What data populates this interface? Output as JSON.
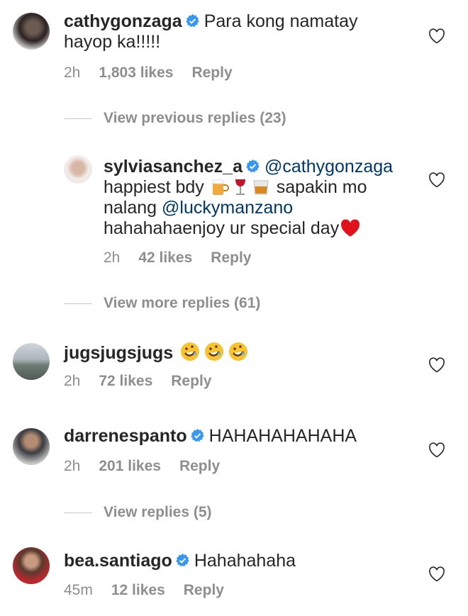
{
  "comments": [
    {
      "user": "cathygonzaga",
      "text": "Para kong namatay",
      "text2": "hayop ka!!!!!",
      "time": "2h",
      "likes": "1,803 likes",
      "reply": "Reply"
    },
    {
      "user": "sylviasanchez_a",
      "mention": "@cathygonzaga",
      "line2a": "happiest bdy",
      "line2b": "sapakin mo",
      "line3a": "nalang",
      "mention2": "@luckymanzano",
      "line4": "hahahahaenjoy ur special day",
      "time": "2h",
      "likes": "42 likes",
      "reply": "Reply"
    },
    {
      "user": "jugsjugsjugs",
      "time": "2h",
      "likes": "72 likes",
      "reply": "Reply"
    },
    {
      "user": "darrenespanto",
      "text": "HAHAHAHAHAHA",
      "time": "2h",
      "likes": "201 likes",
      "reply": "Reply"
    },
    {
      "user": "bea.santiago",
      "text": "Hahahahaha",
      "time": "45m",
      "likes": "12 likes",
      "reply": "Reply"
    }
  ],
  "view_previous": "View previous replies (23)",
  "view_more": "View more replies (61)",
  "view_replies": "View replies (5)",
  "icons": {
    "heart": "heart-outline-icon",
    "verified": "verified-badge-icon"
  }
}
